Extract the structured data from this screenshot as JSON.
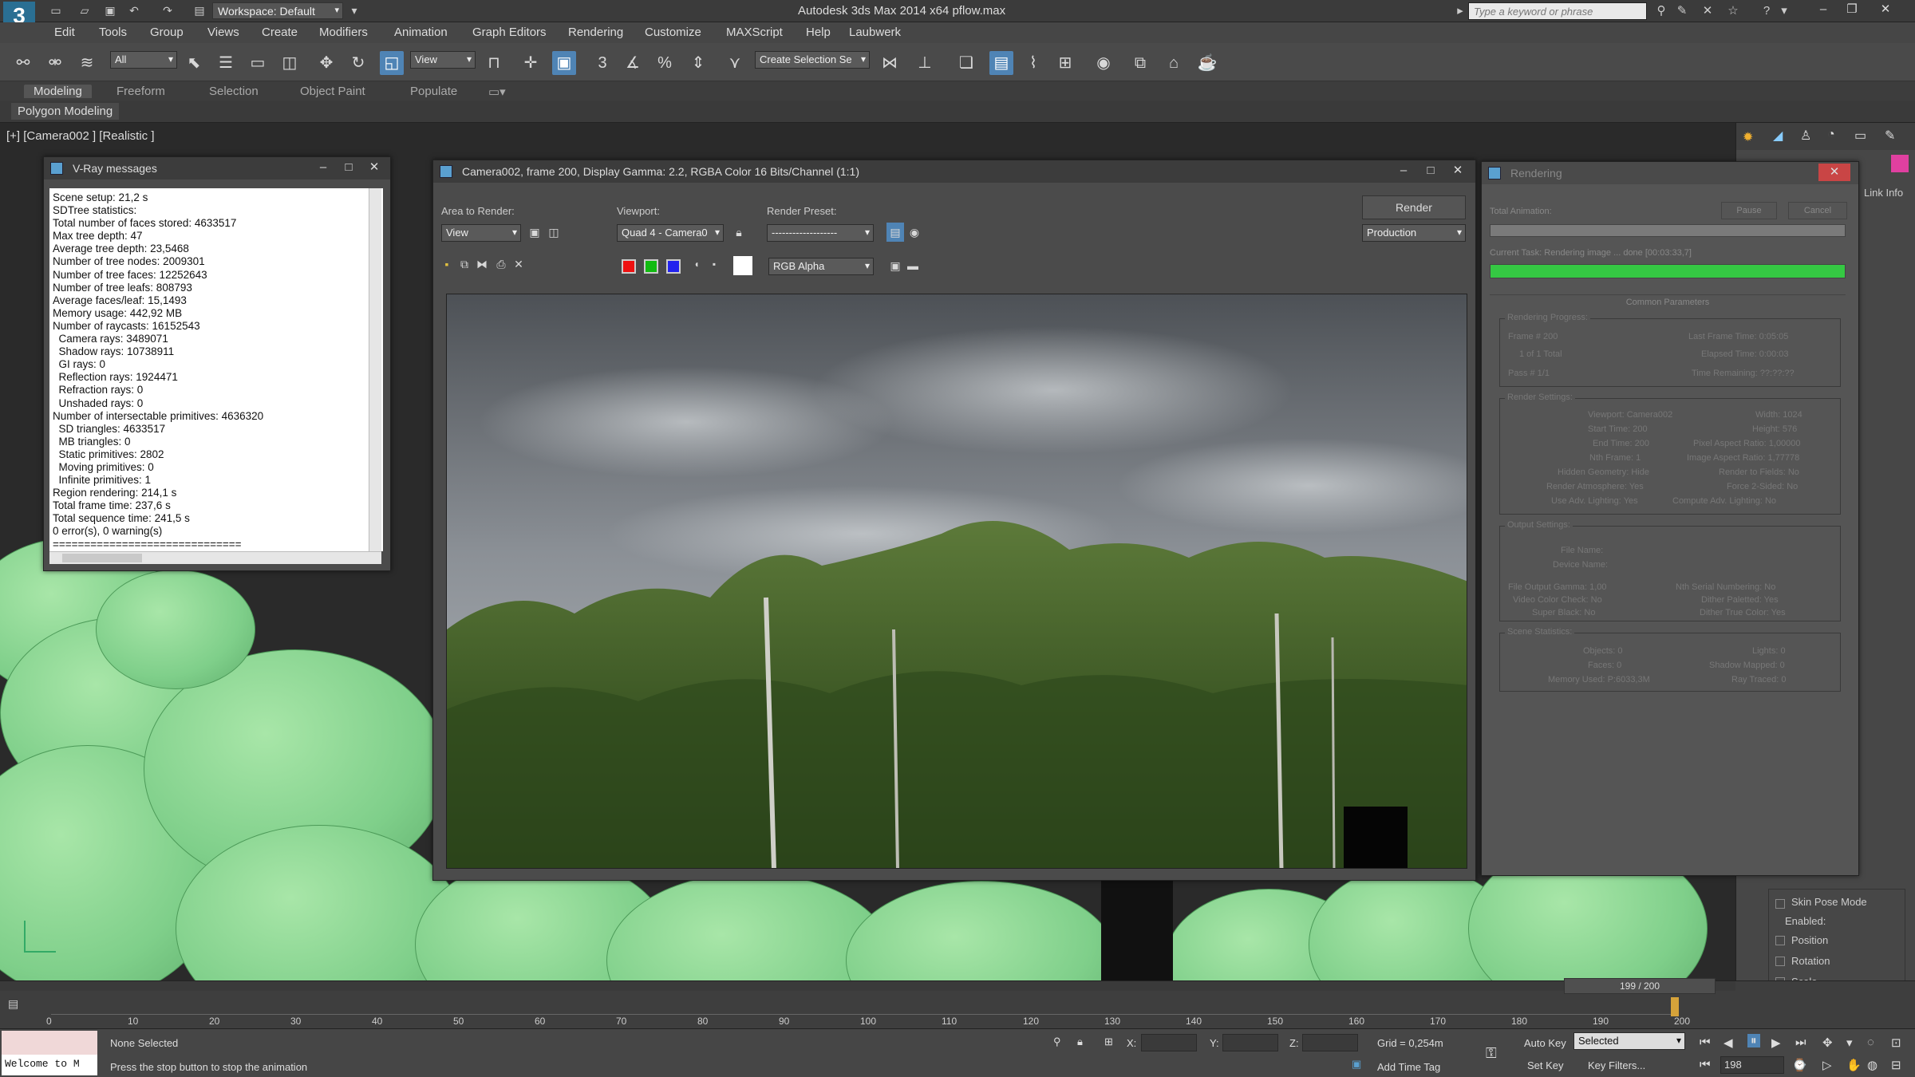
{
  "titlebar": {
    "workspace": "Workspace: Default",
    "app_title": "Autodesk 3ds Max  2014 x64     pflow.max",
    "search_placeholder": "Type a keyword or phrase"
  },
  "menu": [
    "Edit",
    "Tools",
    "Group",
    "Views",
    "Create",
    "Modifiers",
    "Animation",
    "Graph Editors",
    "Rendering",
    "Customize",
    "MAXScript",
    "Help",
    "Laubwerk"
  ],
  "toolbar": {
    "selection_filter": "All",
    "reference_coord": "View",
    "named_selection": "Create Selection Se"
  },
  "ribbon": {
    "tabs": [
      "Modeling",
      "Freeform",
      "Selection",
      "Object Paint",
      "Populate"
    ],
    "active_tab": "Modeling",
    "panel": "Polygon Modeling"
  },
  "viewport": {
    "label": "[+] [Camera002 ] [Realistic ]"
  },
  "vray": {
    "title": "V-Ray messages",
    "lines": [
      "Scene setup: 21,2 s",
      "SDTree statistics:",
      "Total number of faces stored: 4633517",
      "Max tree depth: 47",
      "Average tree depth: 23,5468",
      "Number of tree nodes: 2009301",
      "Number of tree faces: 12252643",
      "Number of tree leafs: 808793",
      "Average faces/leaf: 15,1493",
      "Memory usage: 442,92 MB",
      "Number of raycasts: 16152543",
      "  Camera rays: 3489071",
      "  Shadow rays: 10738911",
      "  GI rays: 0",
      "  Reflection rays: 1924471",
      "  Refraction rays: 0",
      "  Unshaded rays: 0",
      "Number of intersectable primitives: 4636320",
      "  SD triangles: 4633517",
      "  MB triangles: 0",
      "  Static primitives: 2802",
      "  Moving primitives: 0",
      "  Infinite primitives: 1",
      "Region rendering: 214,1 s",
      "Total frame time: 237,6 s",
      "Total sequence time: 241,5 s",
      "0 error(s), 0 warning(s)",
      "=============================="
    ]
  },
  "framebuffer": {
    "title": "Camera002, frame 200, Display Gamma: 2.2, RGBA Color 16 Bits/Channel (1:1)",
    "area_label": "Area to Render:",
    "area_value": "View",
    "viewport_label": "Viewport:",
    "viewport_value": "Quad 4 - Camera0",
    "preset_label": "Render Preset:",
    "preset_value": "-------------------",
    "render_button": "Render",
    "production_value": "Production",
    "channel_value": "RGB Alpha"
  },
  "rendering": {
    "title": "Rendering",
    "pause": "Pause",
    "cancel": "Cancel",
    "total_animation": "Total Animation:",
    "current_task": "Current Task:   Rendering image ... done [00:03:33,7]",
    "progress_total": 0.0,
    "progress_current": 1.0,
    "common_params": "Common Parameters",
    "progress_group": "Rendering Progress:",
    "progress_rows": [
      "Frame #  200",
      "1 of 1        Total",
      "Pass #  1/1",
      "Last Frame Time: 0:05:05",
      "Elapsed Time: 0:00:03",
      "Time Remaining: ??:??:??"
    ],
    "settings_group": "Render Settings:",
    "settings_rows": [
      "Viewport: Camera002",
      "Start Time: 200",
      "End Time: 200",
      "Nth Frame: 1",
      "Hidden Geometry: Hide",
      "Render Atmosphere: Yes",
      "Use Adv. Lighting: Yes",
      "Width: 1024",
      "Height: 576",
      "Pixel Aspect Ratio: 1,00000",
      "Image Aspect Ratio: 1,77778",
      "Render to Fields: No",
      "Force 2-Sided: No",
      "Compute Adv. Lighting: No"
    ],
    "output_group": "Output Settings:",
    "output_rows": [
      "File Name:",
      "Device Name:",
      "File Output Gamma: 1,00",
      "Video Color Check: No",
      "Super Black: No",
      "Nth Serial Numbering: No",
      "Dither Paletted: Yes",
      "Dither True Color: Yes"
    ],
    "scene_group": "Scene Statistics:",
    "scene_rows": [
      "Objects: 0",
      "Faces: 0",
      "Memory Used: P:6033,3M",
      "Lights: 0",
      "Shadow Mapped: 0",
      "Ray Traced: 0"
    ]
  },
  "cmdpanel": {
    "link_info": "Link Info",
    "skin_pose": "Skin Pose Mode",
    "enabled": "Enabled:",
    "position": "Position",
    "rotation": "Rotation",
    "scale": "Scale"
  },
  "timeline": {
    "counter": "199 / 200",
    "ticks": [
      "0",
      "10",
      "20",
      "30",
      "40",
      "50",
      "60",
      "70",
      "80",
      "90",
      "100",
      "110",
      "120",
      "130",
      "140",
      "150",
      "160",
      "170",
      "180",
      "190",
      "200"
    ],
    "position": 199,
    "max": 200
  },
  "status": {
    "maxscript": "Welcome to M",
    "selection": "None Selected",
    "prompt": "Press the stop button to stop the animation",
    "x_label": "X:",
    "y_label": "Y:",
    "z_label": "Z:",
    "grid": "Grid = 0,254m",
    "add_time_tag": "Add Time Tag",
    "auto_key": "Auto Key",
    "set_key": "Set Key",
    "key_mode": "Selected",
    "key_filters": "Key Filters...",
    "frame": "198"
  }
}
